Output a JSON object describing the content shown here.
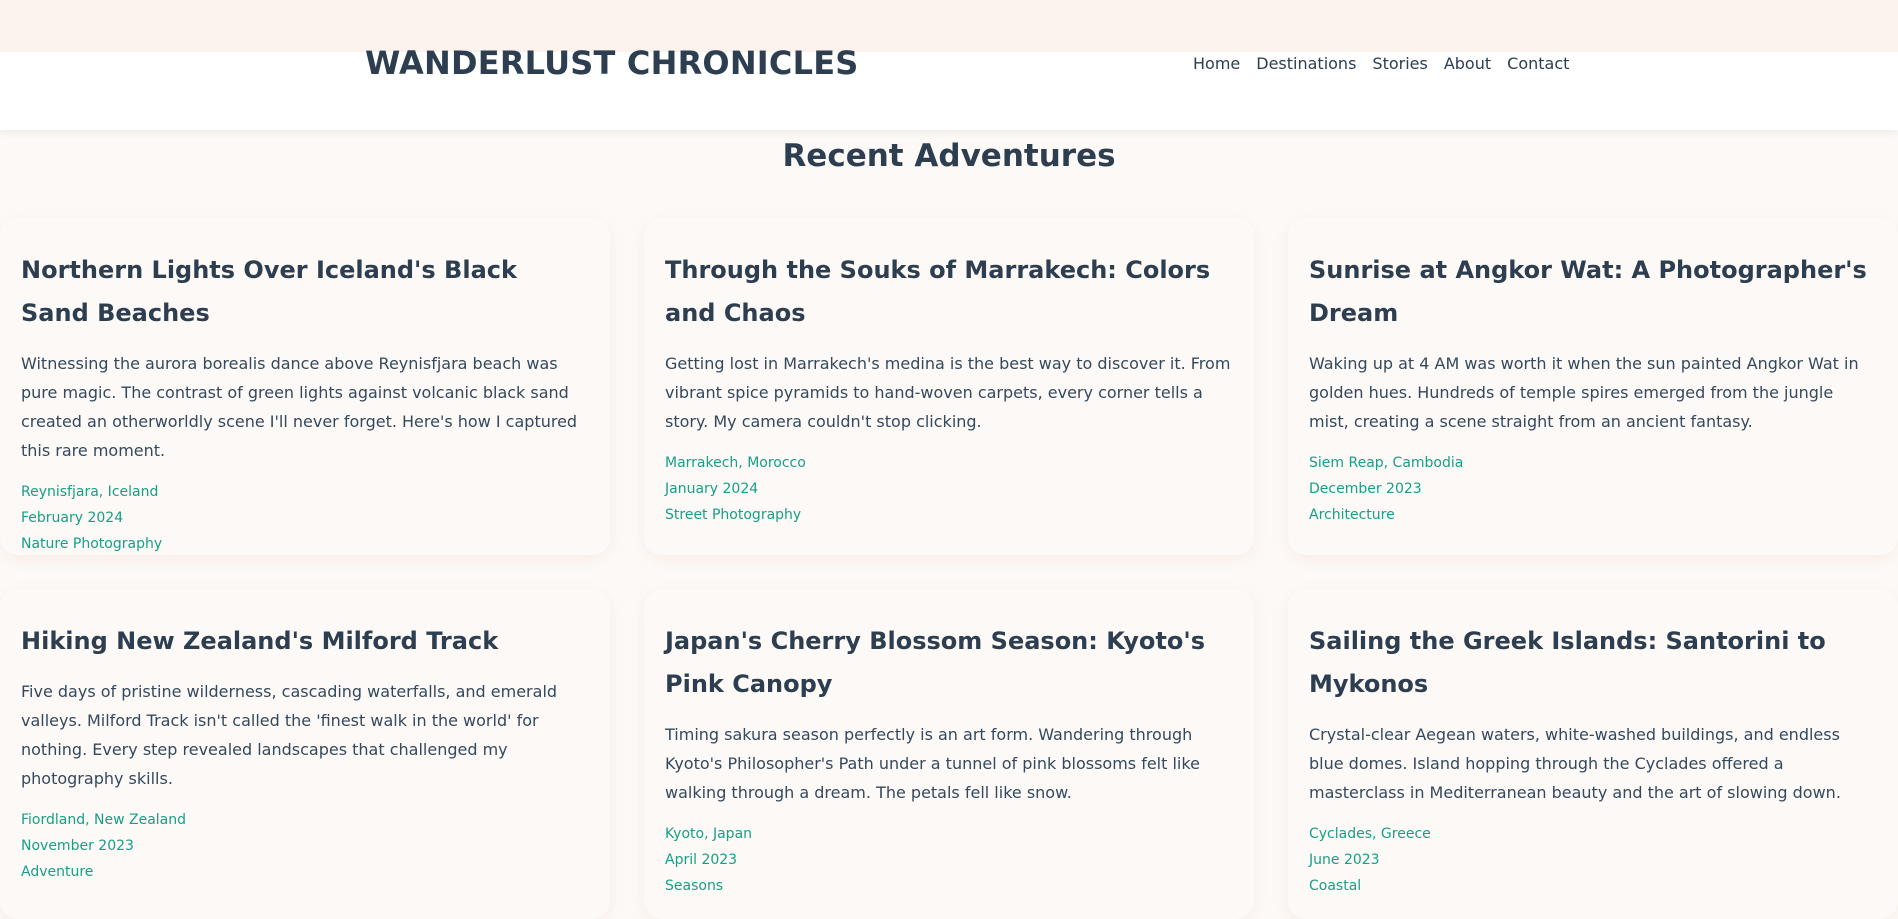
{
  "header": {
    "site_title": "WANDERLUST CHRONICLES",
    "nav": [
      "Home",
      "Destinations",
      "Stories",
      "About",
      "Contact"
    ]
  },
  "main": {
    "section_title": "Recent Adventures",
    "cards": [
      {
        "title": "Northern Lights Over Iceland's Black Sand Beaches",
        "excerpt": "Witnessing the aurora borealis dance above Reynisfjara beach was pure magic. The contrast of green lights against volcanic black sand created an otherworldly scene I'll never forget. Here's how I captured this rare moment.",
        "location": "Reynisfjara, Iceland",
        "date": "February 2024",
        "category": "Nature Photography"
      },
      {
        "title": "Through the Souks of Marrakech: Colors and Chaos",
        "excerpt": "Getting lost in Marrakech's medina is the best way to discover it. From vibrant spice pyramids to hand-woven carpets, every corner tells a story. My camera couldn't stop clicking.",
        "location": "Marrakech, Morocco",
        "date": "January 2024",
        "category": "Street Photography"
      },
      {
        "title": "Sunrise at Angkor Wat: A Photographer's Dream",
        "excerpt": "Waking up at 4 AM was worth it when the sun painted Angkor Wat in golden hues. Hundreds of temple spires emerged from the jungle mist, creating a scene straight from an ancient fantasy.",
        "location": "Siem Reap, Cambodia",
        "date": "December 2023",
        "category": "Architecture"
      },
      {
        "title": "Hiking New Zealand's Milford Track",
        "excerpt": "Five days of pristine wilderness, cascading waterfalls, and emerald valleys. Milford Track isn't called the 'finest walk in the world' for nothing. Every step revealed landscapes that challenged my photography skills.",
        "location": "Fiordland, New Zealand",
        "date": "November 2023",
        "category": "Adventure"
      },
      {
        "title": "Japan's Cherry Blossom Season: Kyoto's Pink Canopy",
        "excerpt": "Timing sakura season perfectly is an art form. Wandering through Kyoto's Philosopher's Path under a tunnel of pink blossoms felt like walking through a dream. The petals fell like snow.",
        "location": "Kyoto, Japan",
        "date": "April 2023",
        "category": "Seasons"
      },
      {
        "title": "Sailing the Greek Islands: Santorini to Mykonos",
        "excerpt": "Crystal-clear Aegean waters, white-washed buildings, and endless blue domes. Island hopping through the Cyclades offered a masterclass in Mediterranean beauty and the art of slowing down.",
        "location": "Cyclades, Greece",
        "date": "June 2023",
        "category": "Coastal"
      }
    ]
  },
  "colors": {
    "heading": "#2c3e50",
    "body_text": "#34495e",
    "meta_accent": "#16a085",
    "page_background": "#fdf9f6",
    "card_background": "#fcf9f7"
  }
}
